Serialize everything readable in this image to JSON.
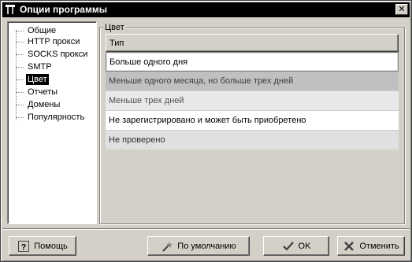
{
  "window": {
    "title": "Опции программы",
    "close_glyph": "✕"
  },
  "sidebar": {
    "items": [
      {
        "label": "Общие"
      },
      {
        "label": "HTTP прокси"
      },
      {
        "label": "SOCKS прокси"
      },
      {
        "label": "SMTP"
      },
      {
        "label": "Цвет",
        "selected": true
      },
      {
        "label": "Отчеты"
      },
      {
        "label": "Домены"
      },
      {
        "label": "Популярность"
      }
    ]
  },
  "color_group": {
    "title": "Цвет",
    "header": "Тип",
    "rows": [
      {
        "label": "Больше одного дня",
        "color": "#ffffff"
      },
      {
        "label": "Меньше одного месяца, но больше трех дней",
        "color": "#c0c0c0"
      },
      {
        "label": "Меньше трех дней",
        "color": "#e8e8e8"
      },
      {
        "label": "Не зарегистрировано и может быть приобретено",
        "color": "#ffffff"
      },
      {
        "label": "Не проверено",
        "color": "#e0e0e0"
      }
    ]
  },
  "buttons": {
    "help": {
      "label": "Помощь",
      "icon": "help-icon"
    },
    "default": {
      "label": "По умолчанию",
      "icon": "wand-icon"
    },
    "ok": {
      "label": "OK",
      "icon": "checkmark-icon"
    },
    "cancel": {
      "label": "Отменить",
      "icon": "cross-icon"
    }
  }
}
